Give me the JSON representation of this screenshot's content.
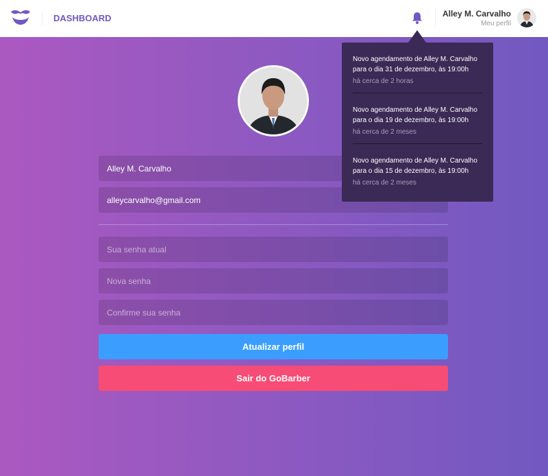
{
  "header": {
    "nav_label": "DASHBOARD",
    "user_name": "Alley M. Carvalho",
    "profile_link": "Meu perfil"
  },
  "notifications": [
    {
      "text": "Novo agendamento de Alley M. Carvalho para o dia 31 de dezembro, às 19:00h",
      "time": "há cerca de 2 horas"
    },
    {
      "text": "Novo agendamento de Alley M. Carvalho para o dia 19 de dezembro, às 19:00h",
      "time": "há cerca de 2 meses"
    },
    {
      "text": "Novo agendamento de Alley M. Carvalho para o dia 15 de dezembro, às 19:00h",
      "time": "há cerca de 2 meses"
    }
  ],
  "form": {
    "name_value": "Alley M. Carvalho",
    "email_value": "alleycarvalho@gmail.com",
    "old_password_placeholder": "Sua senha atual",
    "new_password_placeholder": "Nova senha",
    "confirm_password_placeholder": "Confirme sua senha",
    "update_button": "Atualizar perfil",
    "logout_button": "Sair do GoBarber"
  },
  "colors": {
    "brand": "#7159c1",
    "update": "#3b9eff",
    "logout": "#f64c75",
    "popover": "#3b2a55"
  }
}
